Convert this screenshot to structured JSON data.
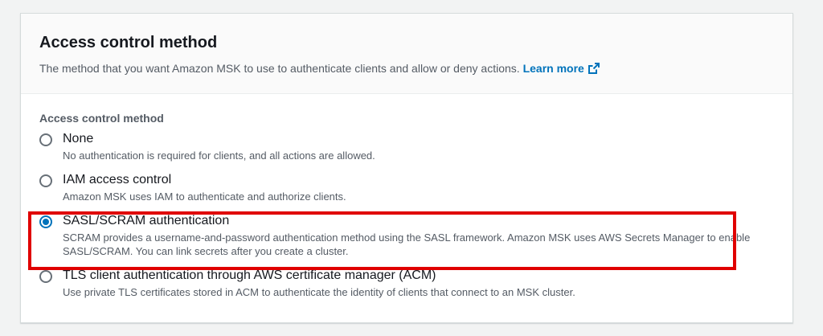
{
  "section": {
    "title": "Access control method",
    "description": "The method that you want Amazon MSK to use to authenticate clients and allow or deny actions.",
    "learn_more": "Learn more"
  },
  "form": {
    "group_label": "Access control method",
    "options": [
      {
        "label": "None",
        "description": "No authentication is required for clients, and all actions are allowed.",
        "selected": false
      },
      {
        "label": "IAM access control",
        "description": "Amazon MSK uses IAM to authenticate and authorize clients.",
        "selected": false
      },
      {
        "label": "SASL/SCRAM authentication",
        "description": "SCRAM provides a username-and-password authentication method using the SASL framework. Amazon MSK uses AWS Secrets Manager to enable SASL/SCRAM. You can link secrets after you create a cluster.",
        "selected": true
      },
      {
        "label": "TLS client authentication through AWS certificate manager (ACM)",
        "description": "Use private TLS certificates stored in ACM to authenticate the identity of clients that connect to an MSK cluster.",
        "selected": false
      }
    ]
  },
  "colors": {
    "accent": "#0073bb",
    "highlight": "#e00000"
  },
  "icons": {
    "learn_more": "external-link-icon",
    "radio": "radio-button-icon"
  }
}
